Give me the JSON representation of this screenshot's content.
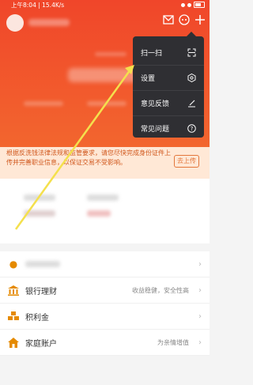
{
  "status_bar": {
    "time": "上午8:04 | 15.4K/s"
  },
  "menu": {
    "items": [
      {
        "label": "扫一扫",
        "icon": "scan-icon"
      },
      {
        "label": "设置",
        "icon": "settings-gear-icon"
      },
      {
        "label": "意见反馈",
        "icon": "feedback-edit-icon"
      },
      {
        "label": "常见问题",
        "icon": "faq-question-icon"
      }
    ]
  },
  "notice": {
    "text": "根据反洗钱法律法规和监管要求，请您尽快完成身份证件上传并完善职业信息，以保证交易不受影响。",
    "button": "去上传"
  },
  "list": {
    "rows": [
      {
        "label": "",
        "sub": "",
        "icon": "coin-icon"
      },
      {
        "label": "银行理财",
        "sub": "收益稳健，安全性高",
        "icon": "bank-icon"
      },
      {
        "label": "积利金",
        "sub": "",
        "icon": "gold-bars-icon"
      },
      {
        "label": "家庭账户",
        "sub": "为亲情增值",
        "icon": "home-icon"
      }
    ]
  },
  "colors": {
    "brand": "#f0462a",
    "menu_bg": "#2f2f33",
    "annotation": "#f4e04d"
  }
}
